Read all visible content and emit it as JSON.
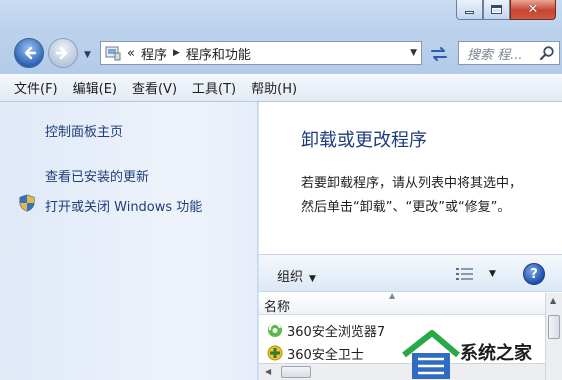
{
  "address": {
    "overflow": "«",
    "crumbs": [
      "程序",
      "程序和功能"
    ]
  },
  "search": {
    "placeholder": "搜索 程..."
  },
  "menu": [
    "文件(F)",
    "编辑(E)",
    "查看(V)",
    "工具(T)",
    "帮助(H)"
  ],
  "sidebar": {
    "items": [
      {
        "label": "控制面板主页"
      },
      {
        "label": "查看已安装的更新"
      },
      {
        "label": "打开或关闭 Windows 功能"
      }
    ]
  },
  "main": {
    "heading": "卸载或更改程序",
    "description": "若要卸载程序，请从列表中将其选中，然后单击“卸载”、“更改”或“修复”。",
    "toolbar": {
      "organize": "组织",
      "help": "?"
    },
    "column_header": "名称",
    "programs": [
      {
        "name": "360安全浏览器7",
        "icon": "browser-icon"
      },
      {
        "name": "360安全卫士",
        "icon": "security-icon"
      }
    ]
  },
  "watermark": {
    "text": "系统之家"
  },
  "colors": {
    "link": "#1e3f7a",
    "heading": "#1e3d7b",
    "accent": "#2d64b6"
  }
}
